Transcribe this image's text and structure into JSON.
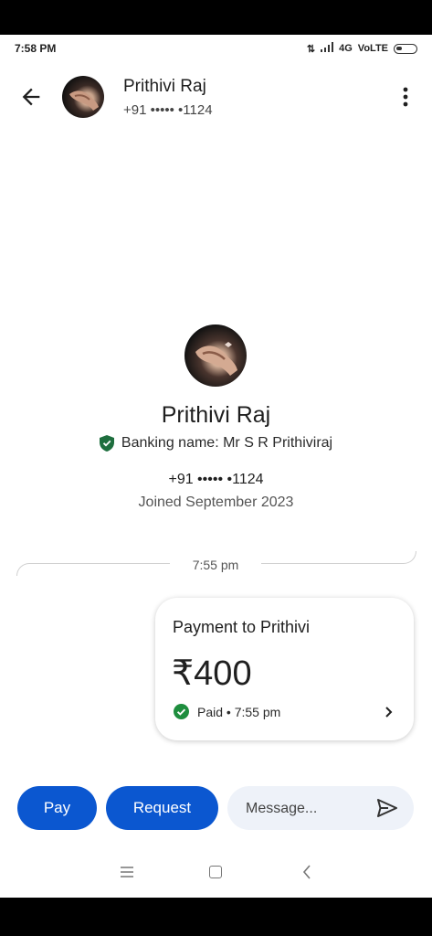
{
  "status_bar": {
    "time": "7:58 PM",
    "network": "4G",
    "volte": "VoLTE"
  },
  "header": {
    "name": "Prithivi Raj",
    "phone": "+91 ••••• •1124"
  },
  "profile": {
    "name": "Prithivi Raj",
    "banking_name": "Banking name: Mr S R Prithiviraj",
    "phone": "+91 ••••• •1124",
    "joined": "Joined September 2023"
  },
  "timeline": {
    "divider_time": "7:55 pm"
  },
  "payment": {
    "title": "Payment to Prithivi",
    "amount": "₹400",
    "status": "Paid • 7:55 pm"
  },
  "actions": {
    "pay_label": "Pay",
    "request_label": "Request",
    "message_placeholder": "Message..."
  },
  "icons": {
    "back": "arrow-back-icon",
    "more": "more-vert-icon",
    "verified": "shield-check-icon",
    "paid": "check-circle-icon",
    "send": "send-icon"
  },
  "colors": {
    "primary": "#0b57d0",
    "verified_green": "#1e6e3e",
    "paid_green": "#1e8e3e"
  }
}
